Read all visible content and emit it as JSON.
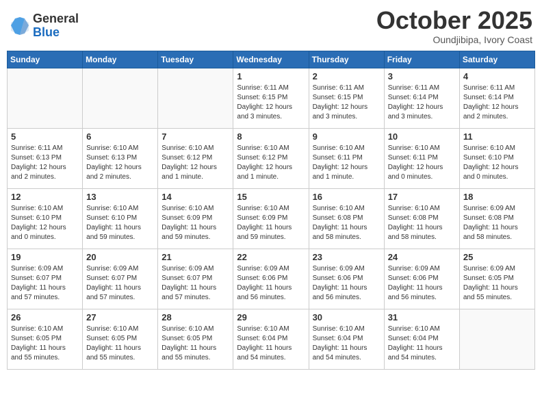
{
  "header": {
    "logo": {
      "general": "General",
      "blue": "Blue"
    },
    "title": "October 2025",
    "location": "Oundjibipa, Ivory Coast"
  },
  "weekdays": [
    "Sunday",
    "Monday",
    "Tuesday",
    "Wednesday",
    "Thursday",
    "Friday",
    "Saturday"
  ],
  "weeks": [
    [
      {
        "day": "",
        "info": ""
      },
      {
        "day": "",
        "info": ""
      },
      {
        "day": "",
        "info": ""
      },
      {
        "day": "1",
        "info": "Sunrise: 6:11 AM\nSunset: 6:15 PM\nDaylight: 12 hours and 3 minutes."
      },
      {
        "day": "2",
        "info": "Sunrise: 6:11 AM\nSunset: 6:15 PM\nDaylight: 12 hours and 3 minutes."
      },
      {
        "day": "3",
        "info": "Sunrise: 6:11 AM\nSunset: 6:14 PM\nDaylight: 12 hours and 3 minutes."
      },
      {
        "day": "4",
        "info": "Sunrise: 6:11 AM\nSunset: 6:14 PM\nDaylight: 12 hours and 2 minutes."
      }
    ],
    [
      {
        "day": "5",
        "info": "Sunrise: 6:11 AM\nSunset: 6:13 PM\nDaylight: 12 hours and 2 minutes."
      },
      {
        "day": "6",
        "info": "Sunrise: 6:10 AM\nSunset: 6:13 PM\nDaylight: 12 hours and 2 minutes."
      },
      {
        "day": "7",
        "info": "Sunrise: 6:10 AM\nSunset: 6:12 PM\nDaylight: 12 hours and 1 minute."
      },
      {
        "day": "8",
        "info": "Sunrise: 6:10 AM\nSunset: 6:12 PM\nDaylight: 12 hours and 1 minute."
      },
      {
        "day": "9",
        "info": "Sunrise: 6:10 AM\nSunset: 6:11 PM\nDaylight: 12 hours and 1 minute."
      },
      {
        "day": "10",
        "info": "Sunrise: 6:10 AM\nSunset: 6:11 PM\nDaylight: 12 hours and 0 minutes."
      },
      {
        "day": "11",
        "info": "Sunrise: 6:10 AM\nSunset: 6:10 PM\nDaylight: 12 hours and 0 minutes."
      }
    ],
    [
      {
        "day": "12",
        "info": "Sunrise: 6:10 AM\nSunset: 6:10 PM\nDaylight: 12 hours and 0 minutes."
      },
      {
        "day": "13",
        "info": "Sunrise: 6:10 AM\nSunset: 6:10 PM\nDaylight: 11 hours and 59 minutes."
      },
      {
        "day": "14",
        "info": "Sunrise: 6:10 AM\nSunset: 6:09 PM\nDaylight: 11 hours and 59 minutes."
      },
      {
        "day": "15",
        "info": "Sunrise: 6:10 AM\nSunset: 6:09 PM\nDaylight: 11 hours and 59 minutes."
      },
      {
        "day": "16",
        "info": "Sunrise: 6:10 AM\nSunset: 6:08 PM\nDaylight: 11 hours and 58 minutes."
      },
      {
        "day": "17",
        "info": "Sunrise: 6:10 AM\nSunset: 6:08 PM\nDaylight: 11 hours and 58 minutes."
      },
      {
        "day": "18",
        "info": "Sunrise: 6:09 AM\nSunset: 6:08 PM\nDaylight: 11 hours and 58 minutes."
      }
    ],
    [
      {
        "day": "19",
        "info": "Sunrise: 6:09 AM\nSunset: 6:07 PM\nDaylight: 11 hours and 57 minutes."
      },
      {
        "day": "20",
        "info": "Sunrise: 6:09 AM\nSunset: 6:07 PM\nDaylight: 11 hours and 57 minutes."
      },
      {
        "day": "21",
        "info": "Sunrise: 6:09 AM\nSunset: 6:07 PM\nDaylight: 11 hours and 57 minutes."
      },
      {
        "day": "22",
        "info": "Sunrise: 6:09 AM\nSunset: 6:06 PM\nDaylight: 11 hours and 56 minutes."
      },
      {
        "day": "23",
        "info": "Sunrise: 6:09 AM\nSunset: 6:06 PM\nDaylight: 11 hours and 56 minutes."
      },
      {
        "day": "24",
        "info": "Sunrise: 6:09 AM\nSunset: 6:06 PM\nDaylight: 11 hours and 56 minutes."
      },
      {
        "day": "25",
        "info": "Sunrise: 6:09 AM\nSunset: 6:05 PM\nDaylight: 11 hours and 55 minutes."
      }
    ],
    [
      {
        "day": "26",
        "info": "Sunrise: 6:10 AM\nSunset: 6:05 PM\nDaylight: 11 hours and 55 minutes."
      },
      {
        "day": "27",
        "info": "Sunrise: 6:10 AM\nSunset: 6:05 PM\nDaylight: 11 hours and 55 minutes."
      },
      {
        "day": "28",
        "info": "Sunrise: 6:10 AM\nSunset: 6:05 PM\nDaylight: 11 hours and 55 minutes."
      },
      {
        "day": "29",
        "info": "Sunrise: 6:10 AM\nSunset: 6:04 PM\nDaylight: 11 hours and 54 minutes."
      },
      {
        "day": "30",
        "info": "Sunrise: 6:10 AM\nSunset: 6:04 PM\nDaylight: 11 hours and 54 minutes."
      },
      {
        "day": "31",
        "info": "Sunrise: 6:10 AM\nSunset: 6:04 PM\nDaylight: 11 hours and 54 minutes."
      },
      {
        "day": "",
        "info": ""
      }
    ]
  ]
}
